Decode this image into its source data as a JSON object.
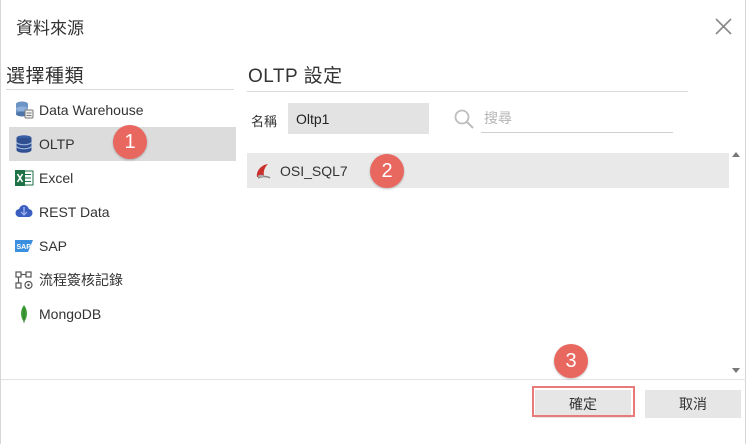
{
  "dialog": {
    "title": "資料來源",
    "close_icon": "close-icon"
  },
  "left": {
    "heading": "選擇種類",
    "items": [
      {
        "label": "Data Warehouse",
        "icon": "data-warehouse-icon",
        "selected": false
      },
      {
        "label": "OLTP",
        "icon": "database-icon",
        "selected": true
      },
      {
        "label": "Excel",
        "icon": "excel-icon",
        "selected": false
      },
      {
        "label": "REST Data",
        "icon": "rest-cloud-icon",
        "selected": false
      },
      {
        "label": "SAP",
        "icon": "sap-icon",
        "selected": false
      },
      {
        "label": "流程簽核記錄",
        "icon": "workflow-icon",
        "selected": false
      },
      {
        "label": "MongoDB",
        "icon": "mongodb-leaf-icon",
        "selected": false
      }
    ]
  },
  "right": {
    "heading": "OLTP 設定",
    "name_label": "名稱",
    "name_value": "Oltp1",
    "search_placeholder": "搜尋",
    "connections": [
      {
        "label": "OSI_SQL7",
        "icon": "sql-server-icon"
      }
    ]
  },
  "footer": {
    "ok_label": "確定",
    "cancel_label": "取消"
  },
  "annotations": {
    "step1": "1",
    "step2": "2",
    "step3": "3",
    "color": "#e8675f"
  }
}
